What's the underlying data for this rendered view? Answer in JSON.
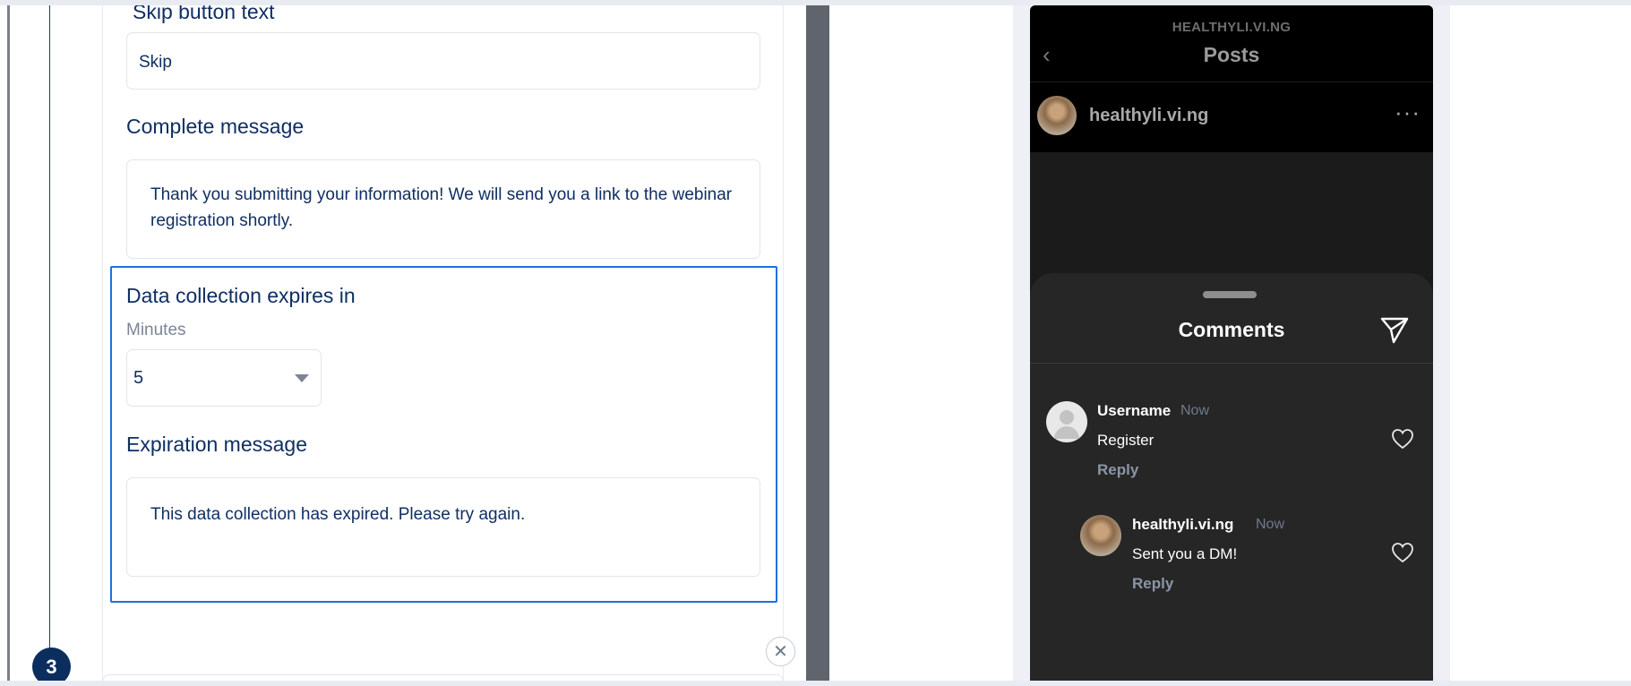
{
  "editor": {
    "skip_label": "Skip  button text",
    "skip_value": "Skip",
    "complete_label": "Complete message",
    "complete_value": "Thank you submitting your information! We will send you a link to the webinar registration shortly.",
    "expire_label": "Data collection expires in",
    "minutes_label": "Minutes",
    "minutes_value": "5",
    "expiration_label": "Expiration message",
    "expiration_value": "This data collection has expired. Please try again.",
    "step_number": "3",
    "close_glyph": "✕"
  },
  "preview": {
    "account": "HEALTHYLI.VI.NG",
    "header_title": "Posts",
    "back_glyph": "‹",
    "post_username": "healthyli.vi.ng",
    "more_glyph": "···",
    "comments_title": "Comments",
    "comments": [
      {
        "username": "Username",
        "time": "Now",
        "text": "Register",
        "reply": "Reply"
      },
      {
        "username": "healthyli.vi.ng",
        "time": "Now",
        "text": "Sent you a DM!",
        "reply": "Reply"
      }
    ]
  },
  "icons": {
    "back": "chevron-left-icon",
    "more": "more-horizontal-icon",
    "send": "send-icon",
    "like": "heart-icon",
    "dropdown": "caret-down-icon",
    "close": "close-icon"
  },
  "colors": {
    "accent": "#1d6fe0",
    "navy": "#0f2f63",
    "badge": "#0b2e5f",
    "phone_bg": "#161616",
    "sheet_bg": "#262626"
  }
}
